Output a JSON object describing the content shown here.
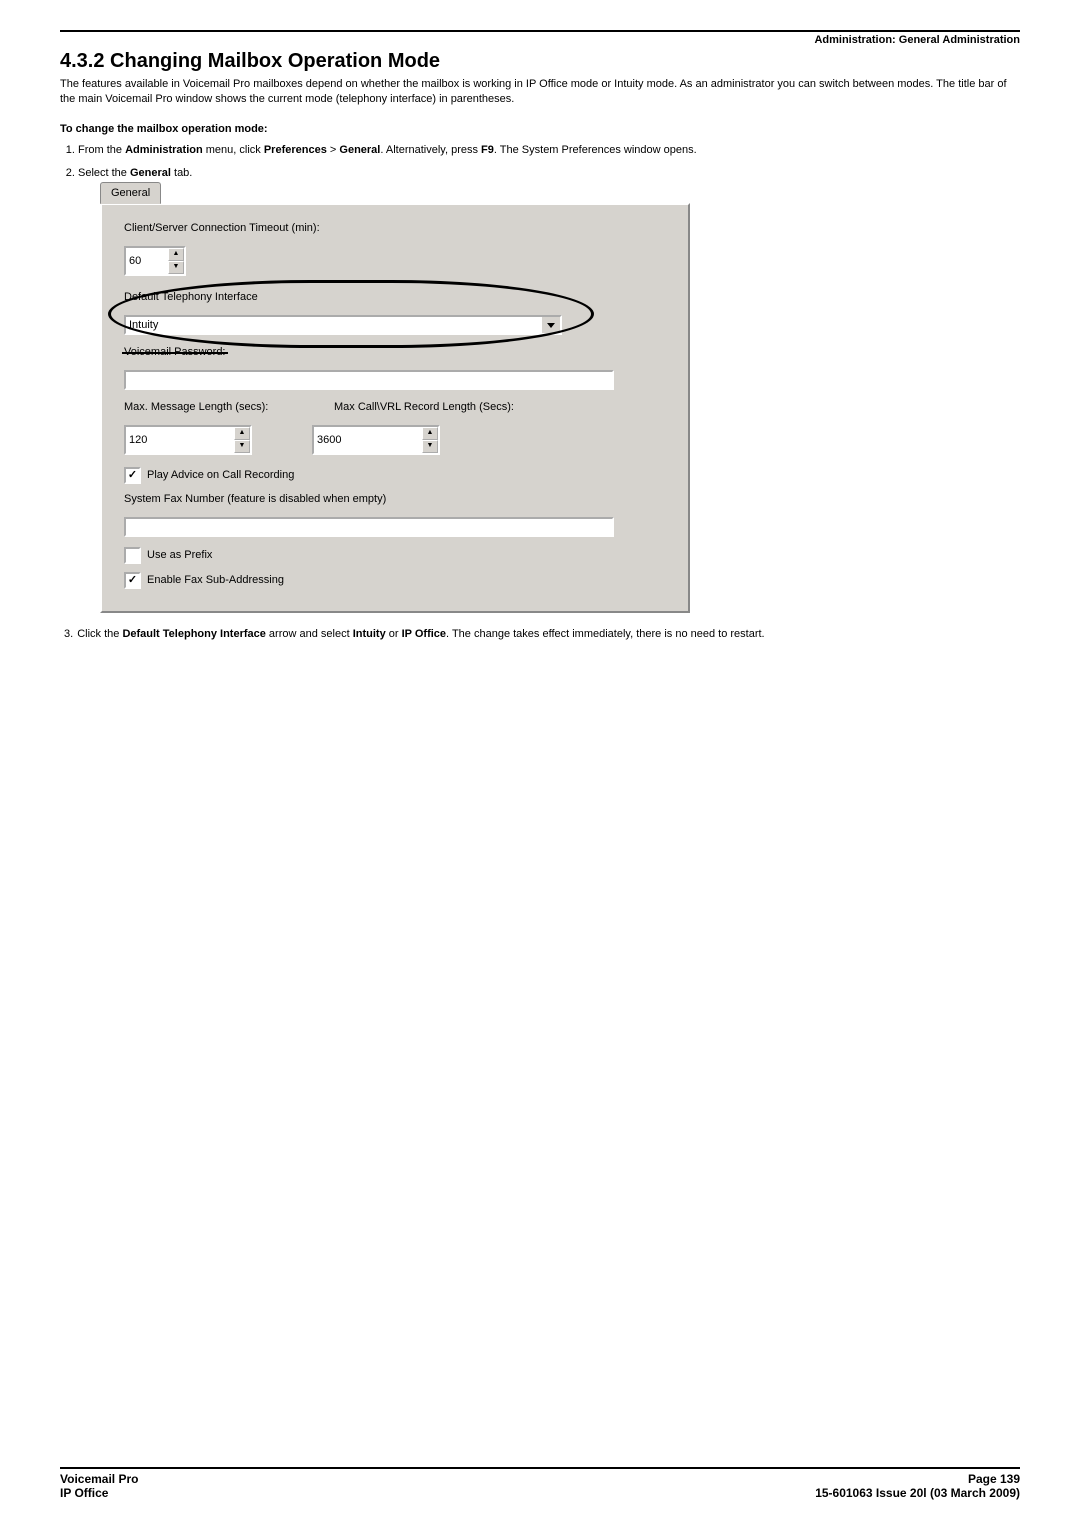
{
  "header": {
    "breadcrumb": "Administration: General Administration"
  },
  "title": "4.3.2 Changing Mailbox Operation Mode",
  "intro": "The features available in Voicemail Pro mailboxes depend on whether the mailbox is working in IP Office mode or Intuity mode. As an administrator you can switch between modes. The title bar of the main Voicemail Pro window shows the current mode (telephony interface) in parentheses.",
  "subhead": "To change the mailbox operation mode:",
  "steps": {
    "s1_a": "From the ",
    "s1_b": "Administration",
    "s1_c": " menu, click ",
    "s1_d": "Preferences",
    "s1_e": " > ",
    "s1_f": "General",
    "s1_g": ". Alternatively, press ",
    "s1_h": "F9",
    "s1_i": ". The System Preferences window opens.",
    "s2_a": "Select the ",
    "s2_b": "General",
    "s2_c": " tab.",
    "s3_a": "Click the ",
    "s3_b": "Default Telephony Interface",
    "s3_c": " arrow and select ",
    "s3_d": "Intuity",
    "s3_e": " or ",
    "s3_f": "IP Office",
    "s3_g": ". The change takes effect immediately, there is no need to restart."
  },
  "dialog": {
    "tab": "General",
    "timeout_label": "Client/Server Connection Timeout (min):",
    "timeout_value": "60",
    "telephony_label": "Default Telephony Interface",
    "telephony_value": "Intuity",
    "vm_pwd_label": "Voicemail Password:",
    "vm_pwd_value": "",
    "max_msg_label": "Max. Message Length (secs):",
    "max_vrl_label": "Max Call\\VRL Record Length (Secs):",
    "max_msg_value": "120",
    "max_vrl_value": "3600",
    "play_advice": "Play Advice on Call Recording",
    "fax_label": "System Fax Number (feature is disabled when empty)",
    "fax_value": "",
    "use_prefix": "Use as Prefix",
    "enable_fax_sub": "Enable Fax Sub-Addressing"
  },
  "footer": {
    "left1": "Voicemail Pro",
    "left2": "IP Office",
    "right1": "Page 139",
    "right2": "15-601063 Issue 20l (03 March 2009)"
  }
}
